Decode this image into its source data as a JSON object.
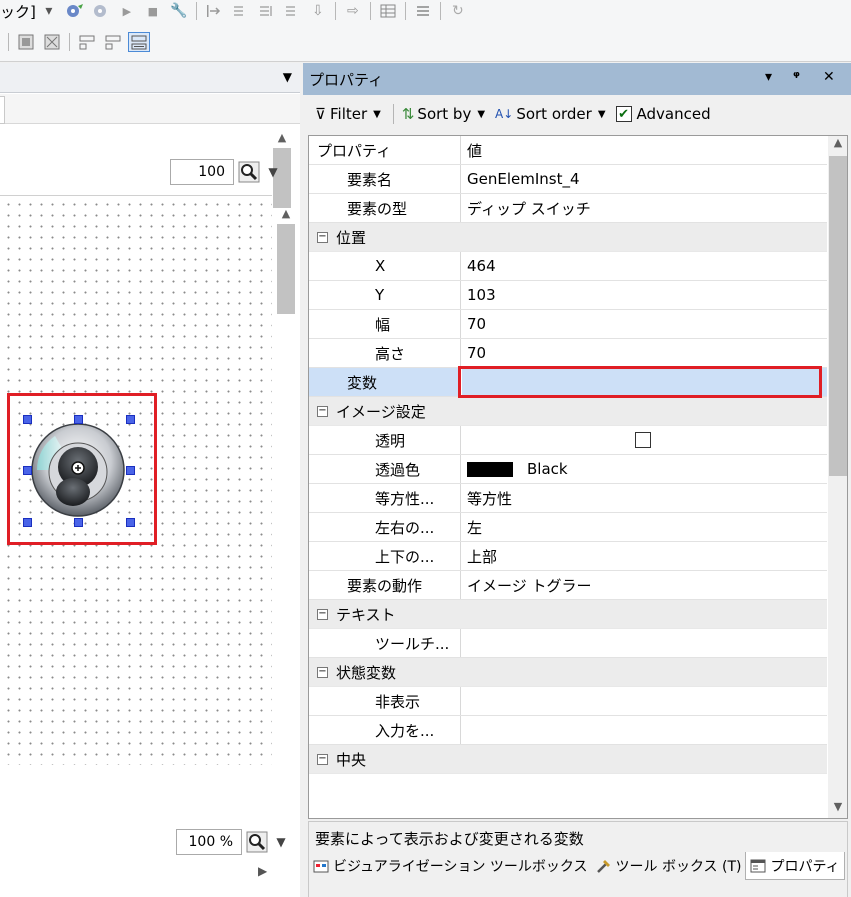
{
  "toolbar": {
    "combo_text": "ック]",
    "icons": [
      "dropdown-arrow",
      "build-icon",
      "build-disabled-icon",
      "run-icon",
      "stop-icon",
      "tool-icon",
      "step-into-icon",
      "step-over-icon",
      "step-out-icon",
      "breakpoint-icon",
      "arrow-icon",
      "grid-icon",
      "list-icon",
      "refresh-icon"
    ]
  },
  "left_panel": {
    "zoom_upper": "100",
    "zoom_lower": "100 %"
  },
  "properties": {
    "title": "プロパティ",
    "filter_label": "Filter",
    "sortby_label": "Sort by",
    "sortorder_label": "Sort order",
    "advanced_label": "Advanced",
    "advanced_checked": true,
    "header": {
      "name": "プロパティ",
      "value": "値"
    },
    "rows": [
      {
        "type": "prop",
        "indent": 1,
        "name": "要素名",
        "value": "GenElemInst_4"
      },
      {
        "type": "prop",
        "indent": 1,
        "name": "要素の型",
        "value": "ディップ スイッチ"
      },
      {
        "type": "cat",
        "name": "位置"
      },
      {
        "type": "prop",
        "indent": 2,
        "name": "X",
        "value": "464"
      },
      {
        "type": "prop",
        "indent": 2,
        "name": "Y",
        "value": "103"
      },
      {
        "type": "prop",
        "indent": 2,
        "name": "幅",
        "value": "70"
      },
      {
        "type": "prop",
        "indent": 2,
        "name": "高さ",
        "value": "70"
      },
      {
        "type": "prop",
        "indent": 1,
        "name": "変数",
        "value": "",
        "selected": true
      },
      {
        "type": "cat",
        "name": "イメージ設定"
      },
      {
        "type": "prop",
        "indent": 2,
        "name": "透明",
        "value": "",
        "checkbox": true
      },
      {
        "type": "prop",
        "indent": 2,
        "name": "透過色",
        "value": "Black",
        "swatch": "#000000"
      },
      {
        "type": "prop",
        "indent": 2,
        "name": "等方性...",
        "value": "等方性"
      },
      {
        "type": "prop",
        "indent": 2,
        "name": "左右の...",
        "value": "左"
      },
      {
        "type": "prop",
        "indent": 2,
        "name": "上下の...",
        "value": "上部"
      },
      {
        "type": "prop",
        "indent": 1,
        "name": "要素の動作",
        "value": "イメージ トグラー"
      },
      {
        "type": "cat",
        "name": "テキスト"
      },
      {
        "type": "prop",
        "indent": 2,
        "name": "ツールチ...",
        "value": ""
      },
      {
        "type": "cat",
        "name": "状態変数"
      },
      {
        "type": "prop",
        "indent": 2,
        "name": "非表示",
        "value": ""
      },
      {
        "type": "prop",
        "indent": 2,
        "name": "入力を...",
        "value": ""
      },
      {
        "type": "cat",
        "name": "中央"
      }
    ],
    "description": "要素によって表示および変更される変数"
  },
  "bottom_tabs": [
    {
      "label": "ビジュアライゼーション ツールボックス",
      "icon": "toolbox-icon"
    },
    {
      "label": "ツール ボックス (T)",
      "icon": "tools-icon"
    },
    {
      "label": "プロパティ",
      "icon": "properties-icon",
      "active": true
    }
  ],
  "colors": {
    "title_bar": "#a2bad3",
    "highlight": "#cde0f7",
    "annotation_red": "#e01e25",
    "handle_blue": "#4a64e8"
  }
}
